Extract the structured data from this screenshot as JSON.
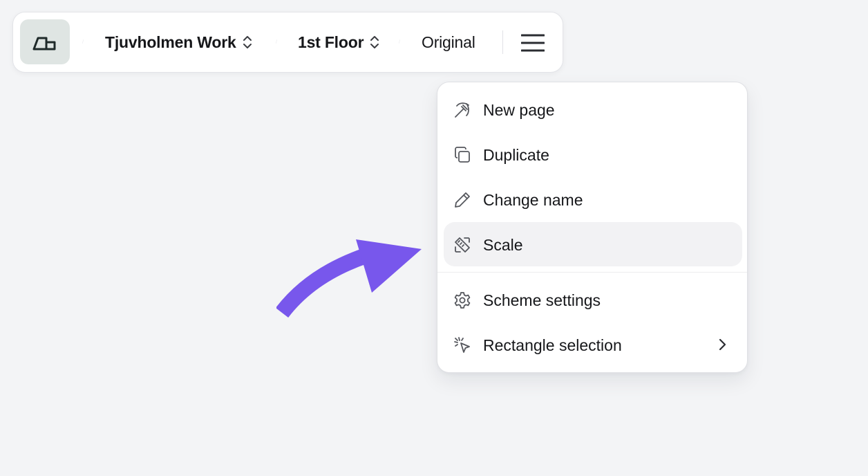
{
  "breadcrumb": {
    "items": [
      {
        "label": "Tjuvholmen Work"
      },
      {
        "label": "1st Floor"
      },
      {
        "label": "Original"
      }
    ]
  },
  "menu": {
    "items": [
      {
        "label": "New page",
        "icon": "pickaxe-icon"
      },
      {
        "label": "Duplicate",
        "icon": "copy-icon"
      },
      {
        "label": "Change name",
        "icon": "pencil-icon"
      },
      {
        "label": "Scale",
        "icon": "ruler-pencil-icon",
        "active": true
      },
      {
        "label": "Scheme settings",
        "icon": "gear-icon"
      },
      {
        "label": "Rectangle selection",
        "icon": "cursor-click-icon",
        "submenu": true
      }
    ]
  },
  "colors": {
    "accent_arrow": "#7857ec",
    "logo_bg": "#dfe5e3",
    "background": "#f3f4f6",
    "hover_bg": "#f2f2f4"
  }
}
